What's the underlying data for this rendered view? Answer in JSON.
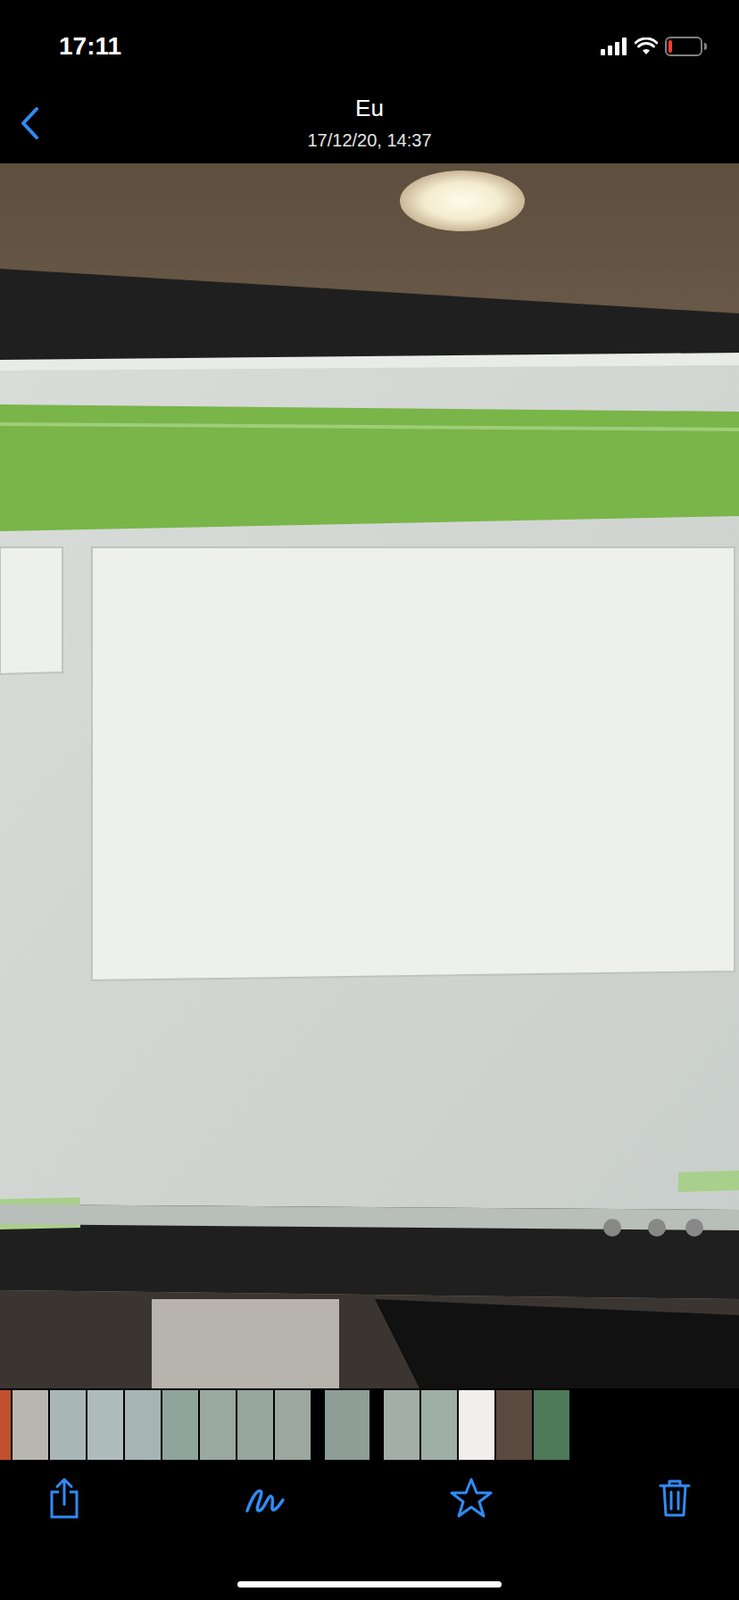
{
  "status_bar": {
    "time": "17:11",
    "battery_level": 0.12,
    "battery_low": true
  },
  "header": {
    "title": "Eu",
    "subtitle": "17/12/20, 14:37"
  },
  "thumbnails": [
    {
      "selected": false,
      "color": "#c0502f"
    },
    {
      "selected": false,
      "color": "#b9b6b0"
    },
    {
      "selected": false,
      "color": "#a9b8b6"
    },
    {
      "selected": false,
      "color": "#aebcbc"
    },
    {
      "selected": false,
      "color": "#a7b4b4"
    },
    {
      "selected": false,
      "color": "#8fa49a"
    },
    {
      "selected": false,
      "color": "#9aa8a2"
    },
    {
      "selected": false,
      "color": "#96a59e"
    },
    {
      "selected": false,
      "color": "#9ca89f"
    },
    {
      "selected": true,
      "color": "#8e9d95"
    },
    {
      "selected": false,
      "color": "#a2aea8"
    },
    {
      "selected": false,
      "color": "#9fafa7"
    },
    {
      "selected": false,
      "color": "#f2eeee"
    },
    {
      "selected": false,
      "color": "#5b4a40"
    },
    {
      "selected": false,
      "color": "#4e7a5a"
    }
  ],
  "toolbar": {
    "favorite": false
  }
}
